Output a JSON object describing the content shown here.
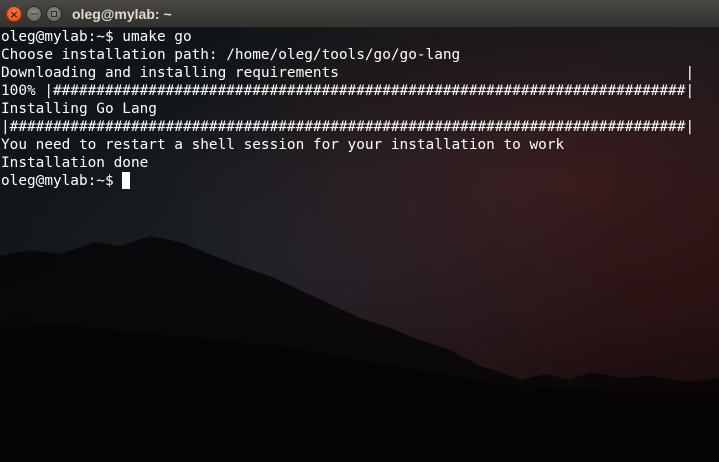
{
  "window": {
    "title": "oleg@mylab: ~",
    "buttons": {
      "close_glyph": "×",
      "minimize_glyph": "—"
    }
  },
  "terminal": {
    "lines": [
      "oleg@mylab:~$ umake go",
      "Choose installation path: /home/oleg/tools/go/go-lang",
      "Downloading and installing requirements                                        |",
      "100% |#########################################################################|",
      "Installing Go Lang",
      "|##############################################################################|",
      "You need to restart a shell session for your installation to work",
      "Installation done"
    ],
    "prompt": "oleg@mylab:~$ "
  },
  "colors": {
    "text": "#ffffff",
    "close_button": "#e9541d",
    "titlebar": "#3a3935"
  }
}
